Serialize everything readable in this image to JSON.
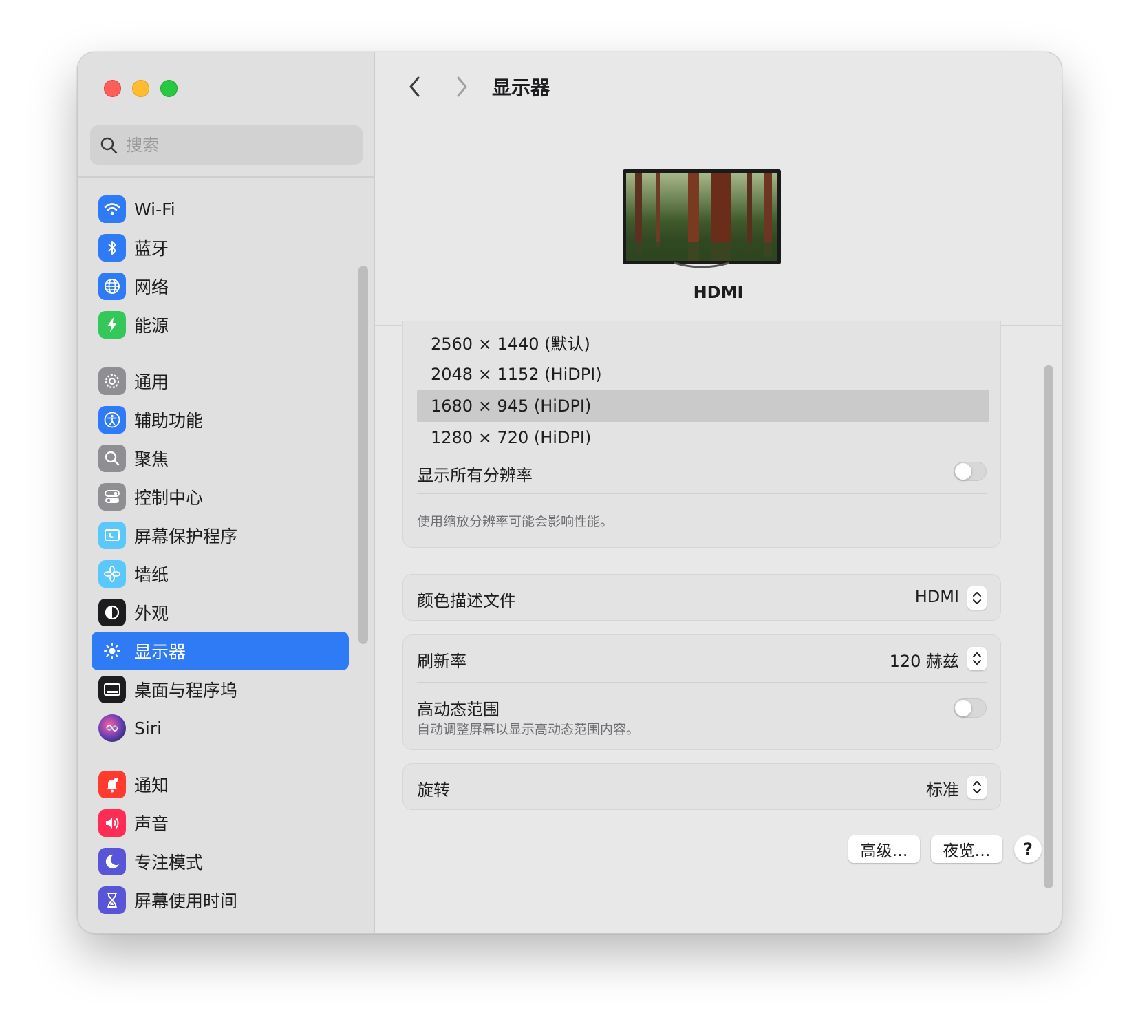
{
  "window": {
    "title": "显示器"
  },
  "sidebar": {
    "search_placeholder": "搜索",
    "items": [
      {
        "label": "Wi-Fi",
        "icon": "wifi-icon",
        "color": "#2f7bf6"
      },
      {
        "label": "蓝牙",
        "icon": "bluetooth-icon",
        "color": "#2f7bf6"
      },
      {
        "label": "网络",
        "icon": "globe-icon",
        "color": "#2f7bf6"
      },
      {
        "label": "能源",
        "icon": "bolt-icon",
        "color": "#34c759"
      },
      {
        "label": "通用",
        "icon": "gear-icon",
        "color": "#8e8e93"
      },
      {
        "label": "辅助功能",
        "icon": "accessibility-icon",
        "color": "#2f7bf6"
      },
      {
        "label": "聚焦",
        "icon": "magnifier-icon",
        "color": "#8e8e93"
      },
      {
        "label": "控制中心",
        "icon": "switches-icon",
        "color": "#8e8e93"
      },
      {
        "label": "屏幕保护程序",
        "icon": "screensaver-icon",
        "color": "#5ac8fa"
      },
      {
        "label": "墙纸",
        "icon": "flower-icon",
        "color": "#5ac8fa"
      },
      {
        "label": "外观",
        "icon": "appearance-icon",
        "color": "#1d1d1f"
      },
      {
        "label": "显示器",
        "icon": "sun-icon",
        "color": "#2f7bf6"
      },
      {
        "label": "桌面与程序坞",
        "icon": "dock-icon",
        "color": "#1d1d1f"
      },
      {
        "label": "Siri",
        "icon": "siri-icon",
        "color": "#5e3cb4"
      },
      {
        "label": "通知",
        "icon": "bell-icon",
        "color": "#ff3b30"
      },
      {
        "label": "声音",
        "icon": "speaker-icon",
        "color": "#ff2d55"
      },
      {
        "label": "专注模式",
        "icon": "moon-icon",
        "color": "#5856d6"
      },
      {
        "label": "屏幕使用时间",
        "icon": "hourglass-icon",
        "color": "#5856d6"
      }
    ]
  },
  "main": {
    "display_name": "HDMI",
    "resolutions": [
      "2560 × 1440 (默认)",
      "2048 × 1152 (HiDPI)",
      "1680 × 945 (HiDPI)",
      "1280 × 720 (HiDPI)"
    ],
    "selected_resolution": "1680 × 945 (HiDPI)",
    "show_all_label": "显示所有分辨率",
    "show_all_on": false,
    "scaling_note": "使用缩放分辨率可能会影响性能。",
    "color_profile_label": "颜色描述文件",
    "color_profile_value": "HDMI",
    "refresh_label": "刷新率",
    "refresh_value": "120 赫兹",
    "hdr_label": "高动态范围",
    "hdr_sub": "自动调整屏幕以显示高动态范围内容。",
    "hdr_on": false,
    "rotation_label": "旋转",
    "rotation_value": "标准",
    "advanced_button": "高级…",
    "night_shift_button": "夜览…",
    "help_button": "?"
  }
}
